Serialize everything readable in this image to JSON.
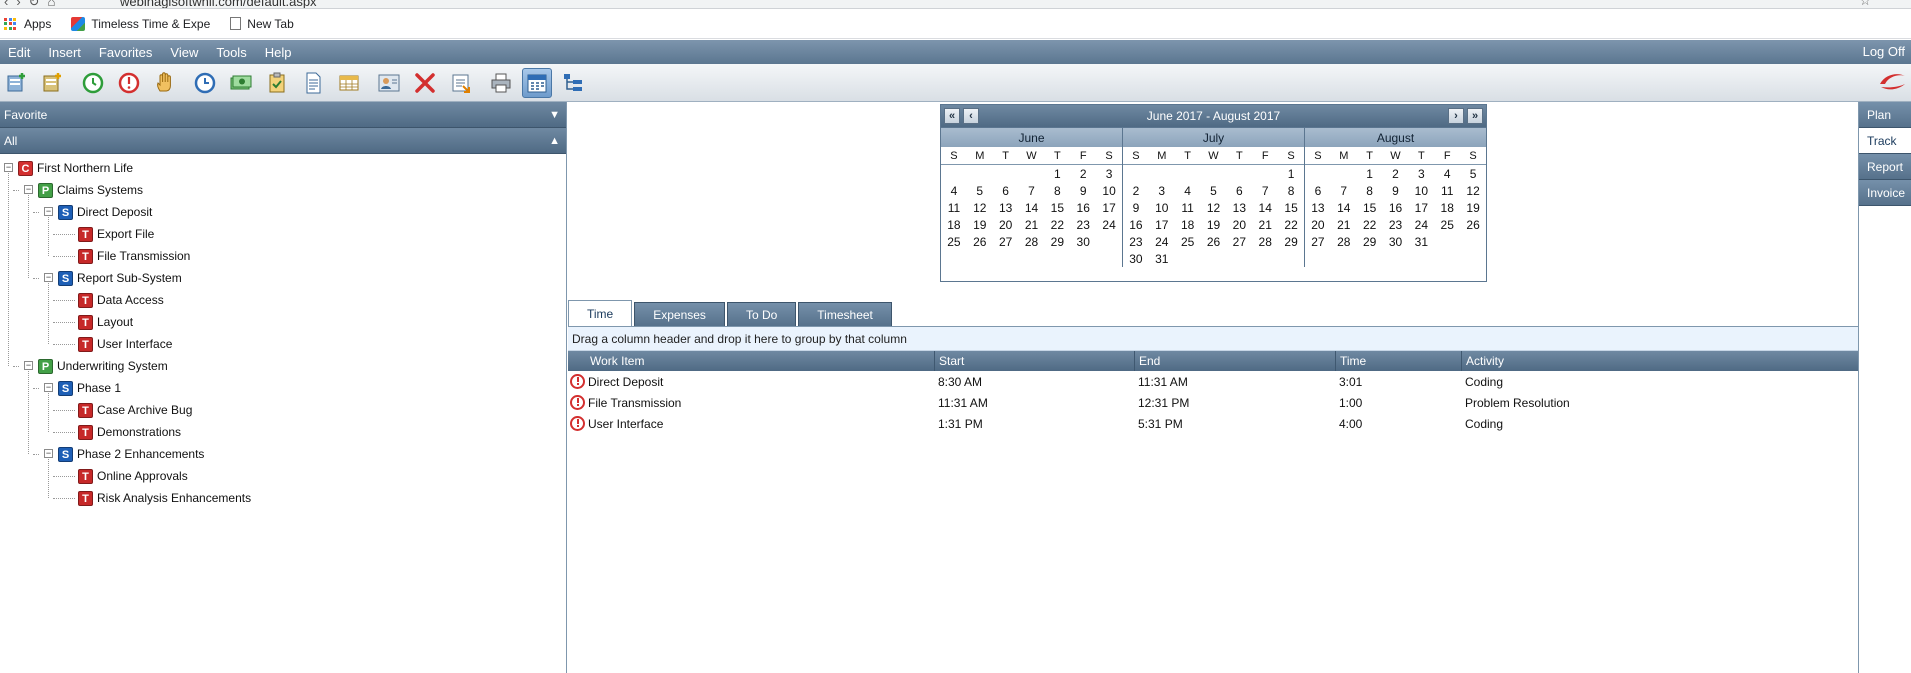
{
  "browser": {
    "url": "webinaglsoftwhil.com/default.aspx",
    "bookmarks": [
      {
        "label": "Apps"
      },
      {
        "label": "Timeless Time & Expe"
      },
      {
        "label": "New Tab"
      }
    ]
  },
  "menu": {
    "items": [
      "Edit",
      "Insert",
      "Favorites",
      "View",
      "Tools",
      "Help"
    ],
    "logoff": "Log Off"
  },
  "toolbar": {
    "icons": [
      "new-folder-icon",
      "new-item-icon",
      "start-clock-icon",
      "stop-clock-icon",
      "hand-icon",
      "timer-icon",
      "money-icon",
      "clipboard-icon",
      "document-icon",
      "grid-icon",
      "user-card-icon",
      "delete-icon",
      "export-icon",
      "print-icon",
      "calendar-icon",
      "tree-icon"
    ],
    "active": "calendar-icon"
  },
  "left_panel": {
    "favorite_label": "Favorite",
    "all_label": "All",
    "tree": [
      {
        "level": 0,
        "type": "C",
        "label": "First Northern Life"
      },
      {
        "level": 1,
        "type": "P",
        "label": "Claims Systems"
      },
      {
        "level": 2,
        "type": "S",
        "label": "Direct Deposit"
      },
      {
        "level": 3,
        "type": "T",
        "label": "Export File"
      },
      {
        "level": 3,
        "type": "T",
        "label": "File Transmission"
      },
      {
        "level": 2,
        "type": "S",
        "label": "Report Sub-System"
      },
      {
        "level": 3,
        "type": "T",
        "label": "Data Access"
      },
      {
        "level": 3,
        "type": "T",
        "label": "Layout"
      },
      {
        "level": 3,
        "type": "T",
        "label": "User Interface"
      },
      {
        "level": 1,
        "type": "P",
        "label": "Underwriting System"
      },
      {
        "level": 2,
        "type": "S",
        "label": "Phase 1"
      },
      {
        "level": 3,
        "type": "T",
        "label": "Case Archive Bug"
      },
      {
        "level": 3,
        "type": "T",
        "label": "Demonstrations"
      },
      {
        "level": 2,
        "type": "S",
        "label": "Phase 2 Enhancements"
      },
      {
        "level": 3,
        "type": "T",
        "label": "Online Approvals"
      },
      {
        "level": 3,
        "type": "T",
        "label": "Risk Analysis Enhancements"
      }
    ]
  },
  "right_nav": {
    "items": [
      "Plan",
      "Track",
      "Report",
      "Invoice"
    ],
    "active": "Track"
  },
  "calendar": {
    "title": "June 2017 - August 2017",
    "prev_year": "«",
    "prev": "‹",
    "next": "›",
    "next_year": "»",
    "dow": [
      "S",
      "M",
      "T",
      "W",
      "T",
      "F",
      "S"
    ],
    "months": [
      {
        "name": "June",
        "start": 4,
        "days": 30
      },
      {
        "name": "July",
        "start": 6,
        "days": 31
      },
      {
        "name": "August",
        "start": 2,
        "days": 31
      }
    ]
  },
  "tabs": {
    "items": [
      "Time",
      "Expenses",
      "To Do",
      "Timesheet"
    ],
    "active": "Time"
  },
  "grid": {
    "group_hint": "Drag a column header and drop it here to group by that column",
    "columns": [
      "Work Item",
      "Start",
      "End",
      "Time",
      "Activity"
    ],
    "rows": [
      {
        "item": "Direct Deposit",
        "start": "8:30 AM",
        "end": "11:31 AM",
        "time": "3:01",
        "activity": "Coding"
      },
      {
        "item": "File Transmission",
        "start": "11:31 AM",
        "end": "12:31 PM",
        "time": "1:00",
        "activity": "Problem Resolution"
      },
      {
        "item": "User Interface",
        "start": "1:31 PM",
        "end": "5:31 PM",
        "time": "4:00",
        "activity": "Coding"
      }
    ]
  }
}
